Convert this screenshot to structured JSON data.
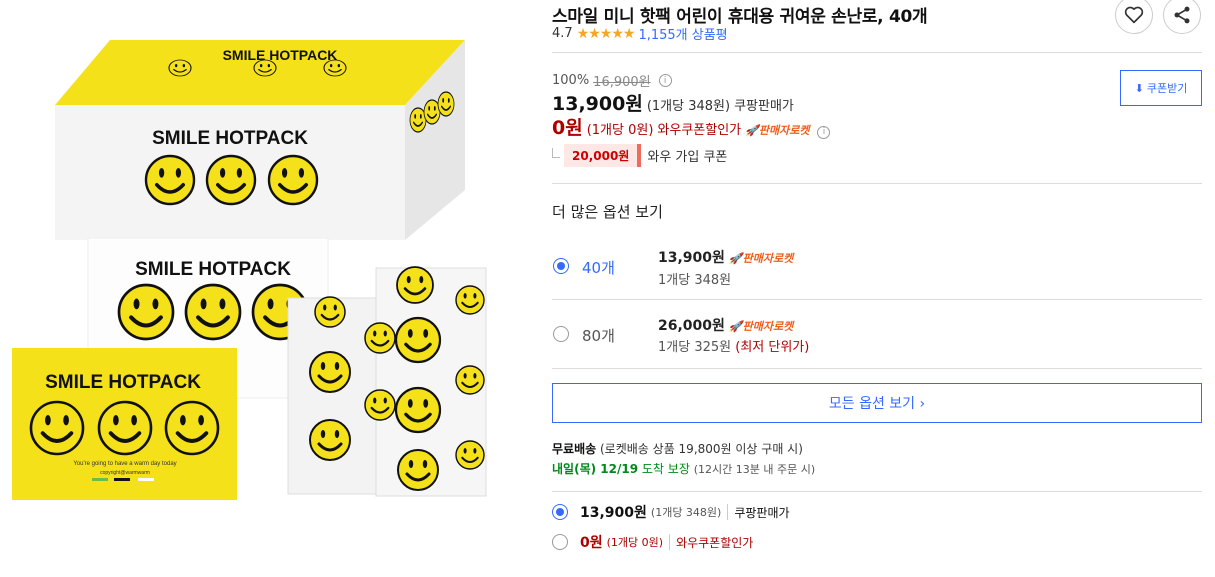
{
  "product": {
    "title": "스마일 미니 핫팩 어린이 휴대용 귀여운 손난로, 40개",
    "rating_score": "4.7",
    "stars": "★★★★★",
    "review_count": "1,155개 상품평"
  },
  "image": {
    "box_top_text": "SMILE HOTPACK",
    "box_front_text": "SMILE HOTPACK",
    "card_text": "SMILE HOTPACK",
    "pouch_text": "SMILE HOTPACK",
    "tagline": "You're going to have a warm day today",
    "copyright": "copyright@warmwarm",
    "rating": 4.7
  },
  "pricing": {
    "discount_rate": "100%",
    "original_price": "16,900원",
    "info_glyph": "i",
    "coupon_button": "쿠폰받기",
    "sale_price": "13,900원",
    "sale_unit": "(1개당 348원)",
    "sale_label": "쿠팡판매가",
    "wow_price": "0원",
    "wow_unit": "(1개당 0원)",
    "wow_label": "와우쿠폰할인가",
    "rocket_label": "판매자로켓",
    "join_amount": "20,000원",
    "join_label": "와우 가입 쿠폰"
  },
  "options": {
    "heading": "더 많은 옵션 보기",
    "items": [
      {
        "name": "40개",
        "price": "13,900원",
        "rocket": "판매자로켓",
        "unit": "1개당 348원",
        "note": "",
        "selected": true
      },
      {
        "name": "80개",
        "price": "26,000원",
        "rocket": "판매자로켓",
        "unit": "1개당 325원",
        "note": "(최저 단위가)",
        "selected": false
      }
    ],
    "all_button": "모든 옵션 보기 ›"
  },
  "shipping": {
    "free_label": "무료배송",
    "free_detail": "(로켓배송 상품 19,800원 이상 구매 시)",
    "arrival_date": "내일(목) 12/19",
    "arrival_text": "도착 보장",
    "arrival_note": "(12시간 13분 내 주문 시)"
  },
  "purchase_options": [
    {
      "price": "13,900원",
      "unit": "(1개당 348원)",
      "label": "쿠팡판매가",
      "selected": true
    },
    {
      "price": "0원",
      "unit": "(1개당 0원)",
      "label": "와우쿠폰할인가",
      "selected": false
    }
  ],
  "colors": {
    "accent": "#346aff",
    "price_red": "#ae0000",
    "rocket": "#ee5e1b",
    "pack_yellow": "#f5e11a"
  }
}
